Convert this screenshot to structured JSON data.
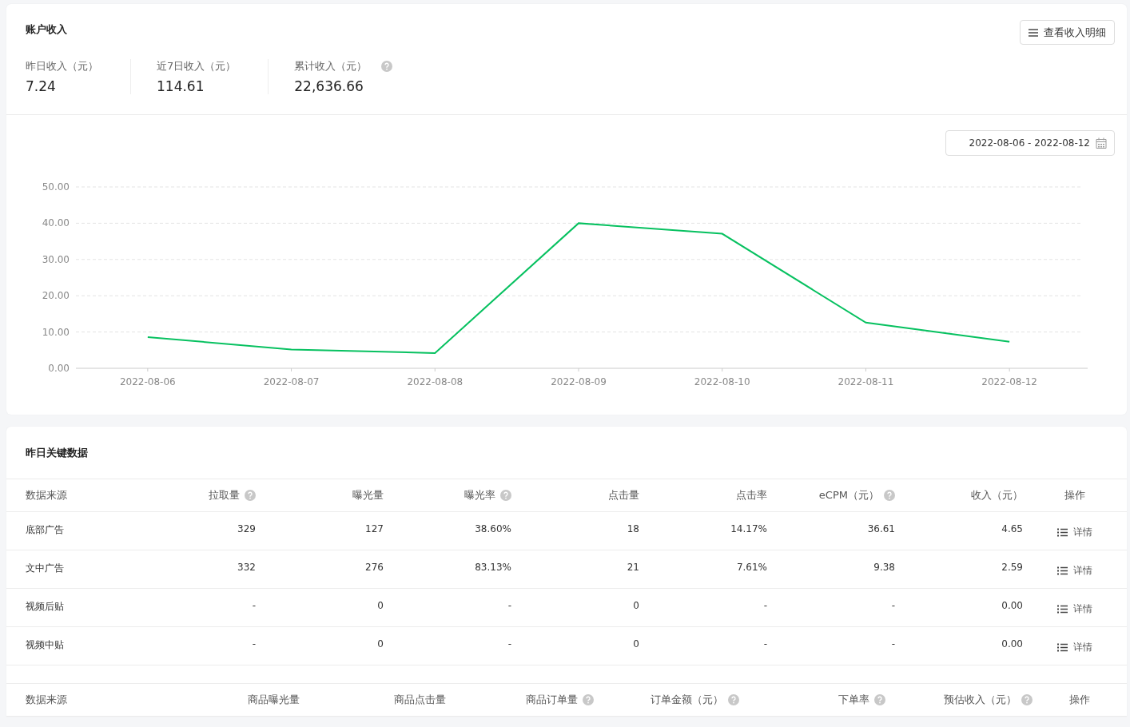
{
  "income_card": {
    "title": "账户收入",
    "detail_button": "查看收入明细",
    "stats": [
      {
        "label": "昨日收入（元）",
        "value": "7.24",
        "help": false
      },
      {
        "label": "近7日收入（元）",
        "value": "114.61",
        "help": false
      },
      {
        "label": "累计收入（元）",
        "value": "22,636.66",
        "help": true
      }
    ],
    "date_range": "2022-08-06 - 2022-08-12",
    "chart_data": {
      "type": "line",
      "categories": [
        "2022-08-06",
        "2022-08-07",
        "2022-08-08",
        "2022-08-09",
        "2022-08-10",
        "2022-08-11",
        "2022-08-12"
      ],
      "series": [
        {
          "color": "#07c160",
          "values": [
            8.6,
            5.2,
            4.2,
            40.0,
            37.1,
            12.6,
            7.3
          ]
        }
      ],
      "ylim": [
        0,
        50
      ],
      "grid": true,
      "yticks": [
        {
          "value": 0,
          "label": "0.00"
        },
        {
          "value": 10,
          "label": "10.00"
        },
        {
          "value": 20,
          "label": "20.00"
        },
        {
          "value": 30,
          "label": "30.00"
        },
        {
          "value": 40,
          "label": "40.00"
        },
        {
          "value": 50,
          "label": "50.00"
        }
      ]
    }
  },
  "key_data_card": {
    "title": "昨日关键数据",
    "ad_table": {
      "columns": [
        {
          "label": "数据来源",
          "help": false
        },
        {
          "label": "拉取量",
          "help": true
        },
        {
          "label": "曝光量",
          "help": false
        },
        {
          "label": "曝光率",
          "help": true
        },
        {
          "label": "点击量",
          "help": false
        },
        {
          "label": "点击率",
          "help": false
        },
        {
          "label": "eCPM（元）",
          "help": true
        },
        {
          "label": "收入（元）",
          "help": false
        },
        {
          "label": "操作",
          "help": false
        }
      ],
      "rows": [
        {
          "cells": [
            "底部广告",
            "329",
            "127",
            "38.60%",
            "18",
            "14.17%",
            "36.61",
            "4.65"
          ],
          "action": "详情"
        },
        {
          "cells": [
            "文中广告",
            "332",
            "276",
            "83.13%",
            "21",
            "7.61%",
            "9.38",
            "2.59"
          ],
          "action": "详情"
        },
        {
          "cells": [
            "视频后贴",
            "-",
            "0",
            "-",
            "0",
            "-",
            "-",
            "0.00"
          ],
          "action": "详情"
        },
        {
          "cells": [
            "视频中贴",
            "-",
            "0",
            "-",
            "0",
            "-",
            "-",
            "0.00"
          ],
          "action": "详情"
        }
      ]
    },
    "goods_table": {
      "columns": [
        {
          "label": "数据来源",
          "help": false
        },
        {
          "label": "商品曝光量",
          "help": false
        },
        {
          "label": "商品点击量",
          "help": false
        },
        {
          "label": "商品订单量",
          "help": true
        },
        {
          "label": "订单金额（元）",
          "help": true
        },
        {
          "label": "下单率",
          "help": true
        },
        {
          "label": "预估收入（元）",
          "help": true
        },
        {
          "label": "操作",
          "help": false
        }
      ]
    }
  }
}
